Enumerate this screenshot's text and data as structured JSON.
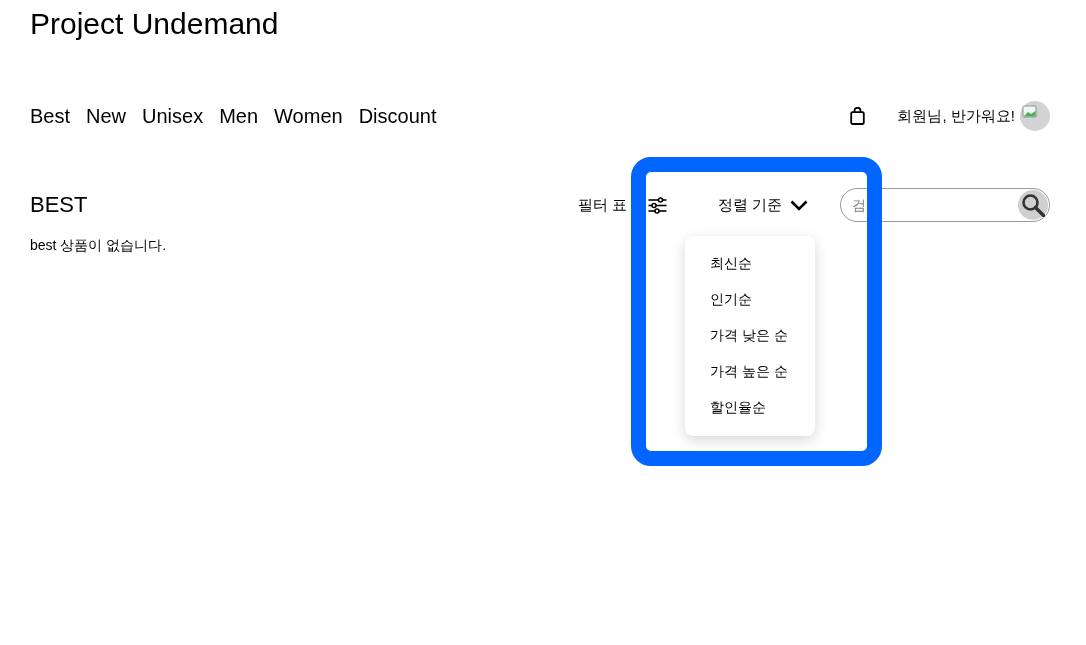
{
  "site_title": "Project Undemand",
  "nav": {
    "items": [
      {
        "label": "Best"
      },
      {
        "label": "New"
      },
      {
        "label": "Unisex"
      },
      {
        "label": "Men"
      },
      {
        "label": "Women"
      },
      {
        "label": "Discount"
      }
    ]
  },
  "user": {
    "greeting": "회원님, 반가워요!"
  },
  "section": {
    "title": "BEST",
    "empty_message": "best 상품이 없습니다."
  },
  "toolbar": {
    "filter_label": "필터 표",
    "sort_label": "정렬 기준",
    "search": {
      "placeholder": "검"
    }
  },
  "sort_menu": {
    "expanded": true,
    "options": [
      {
        "label": "최신순"
      },
      {
        "label": "인기순"
      },
      {
        "label": "가격 낮은 순"
      },
      {
        "label": "가격 높은 순"
      },
      {
        "label": "할인율순"
      }
    ]
  }
}
